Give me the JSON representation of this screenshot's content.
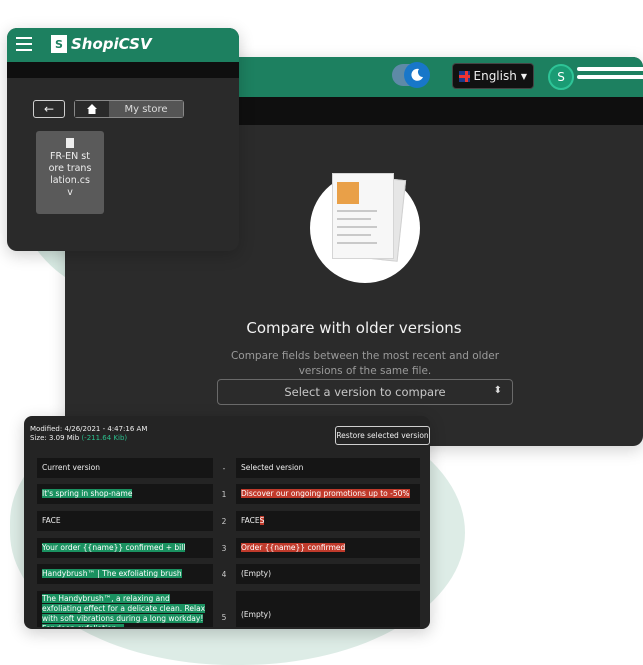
{
  "app": {
    "name": "ShopiCSV"
  },
  "header": {
    "language": "English",
    "avatar_initial": "S"
  },
  "breadcrumb": {
    "back": "←",
    "store": "My store"
  },
  "file": {
    "name": "FR-EN store translation.csv"
  },
  "compare": {
    "title": "Compare with older versions",
    "description": "Compare fields between the most recent and older versions of the same file.",
    "select_placeholder": "Select a version to compare"
  },
  "version_panel": {
    "modified": "Modified: 4/26/2021 - 4:47:16 AM",
    "size_label": "Size: 3.09 Mib",
    "size_delta": "(-211.64 Kib)",
    "restore_button": "Restore selected version",
    "header_current": "Current version",
    "header_sep": "-",
    "header_selected": "Selected version",
    "rows": [
      {
        "n": "1",
        "cur_pre": "It's spring",
        "cur_hl": " in shop-name",
        "sel_hl": "Discover",
        "sel_post": " our ongoing promotions up to -50%"
      },
      {
        "n": "2",
        "cur_pre": "FACE",
        "cur_hl": "",
        "sel_pre": "FACE",
        "sel_hl": "S"
      },
      {
        "n": "3",
        "cur_hl": "Your order {{name}} confirmed + bill",
        "sel_hl": "Order {{name}} confirmed"
      },
      {
        "n": "4",
        "cur_hl": "Handybrush™ | The exfoliating brush",
        "sel": "(Empty)"
      },
      {
        "n": "5",
        "cur_hl": "The Handybrush™, a relaxing and exfoliating effect for a delicate clean. Relax with soft vibrations during a long workday! For deep exfoliation...",
        "sel": "(Empty)"
      }
    ]
  },
  "colors": {
    "brand_green": "#1d8060",
    "diff_added": "#1a9160",
    "diff_removed": "#c03a2b"
  }
}
